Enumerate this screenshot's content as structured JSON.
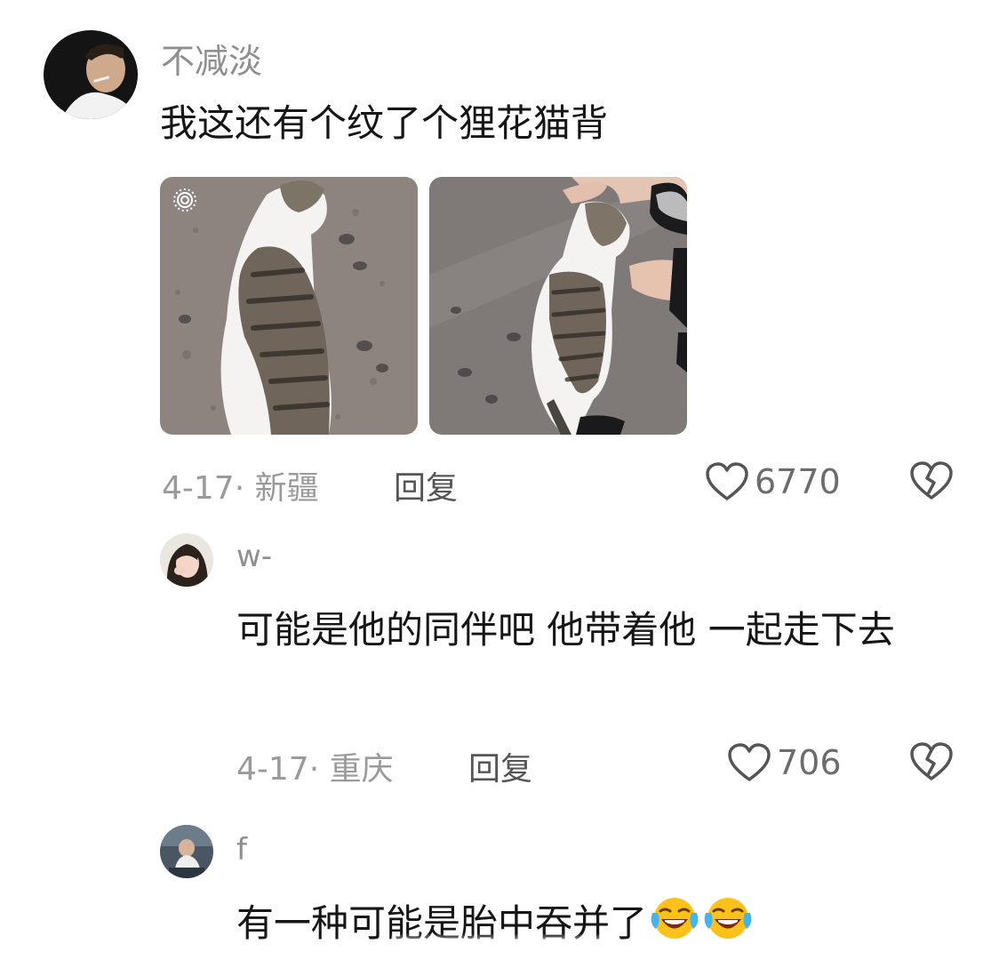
{
  "comments": [
    {
      "username": "不减淡",
      "text": "我这还有个纹了个狸花猫背",
      "date_location": "4-17· 新疆",
      "reply_label": "回复",
      "likes": "6770",
      "photos": [
        "cat-photo-1",
        "cat-photo-2"
      ],
      "live_photo_icon": "live-photo-icon"
    },
    {
      "username": "w-",
      "text": "可能是他的同伴吧 他带着他 一起走下去",
      "date_location": "4-17· 重庆",
      "reply_label": "回复",
      "likes": "706"
    },
    {
      "username": "f",
      "text": "有一种可能是胎中吞并了",
      "emojis": [
        "rofl-emoji",
        "rofl-emoji"
      ]
    }
  ],
  "icons": {
    "like": "heart-outline-icon",
    "dislike": "broken-heart-icon"
  },
  "colors": {
    "username": "#8f8f8f",
    "meta": "#9a9a9a",
    "text": "#161616",
    "icon": "#555555"
  }
}
